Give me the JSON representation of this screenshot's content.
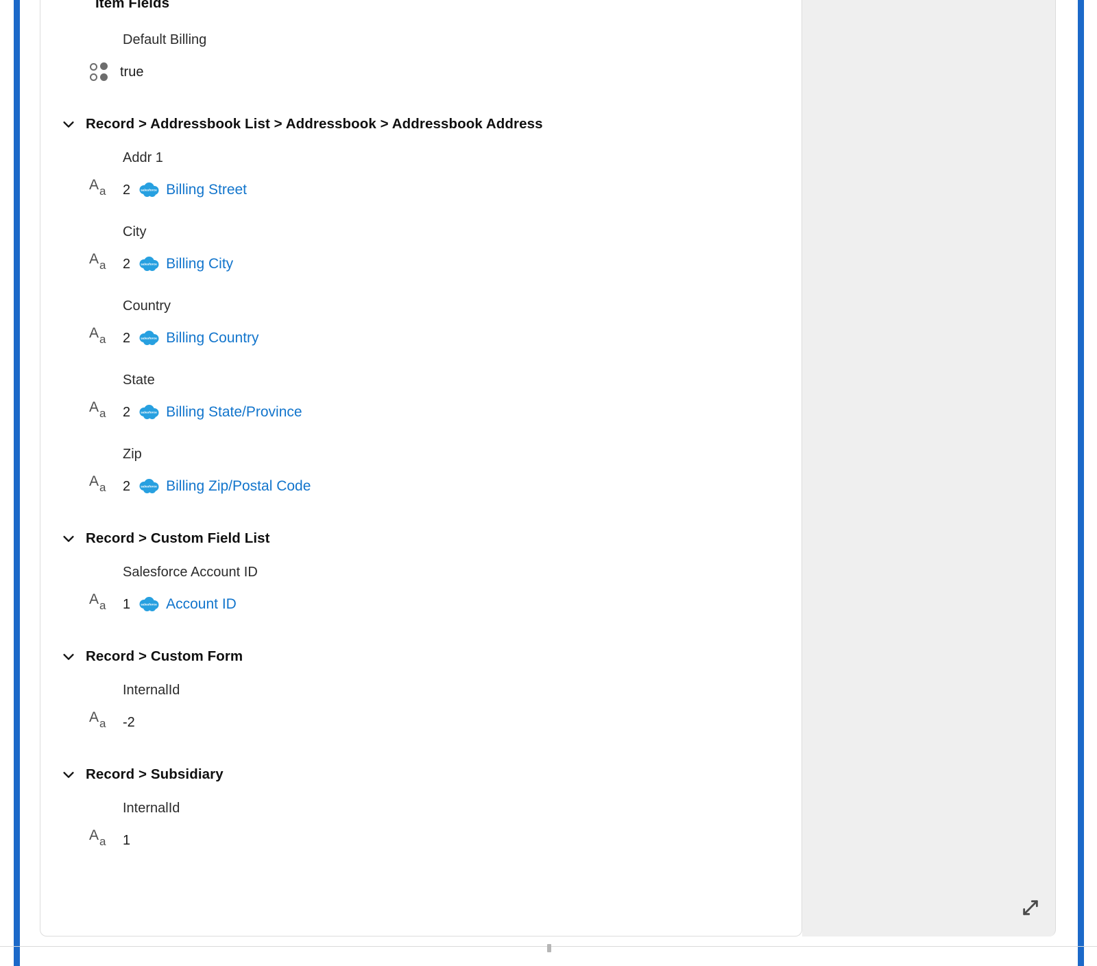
{
  "theme": {
    "rail_color": "#1b69c9",
    "link_color": "#1275cc",
    "panel_bg": "#efefef",
    "card_bg": "#ffffff",
    "border_color": "#dcdcdc"
  },
  "item_fields": {
    "heading": "Item Fields",
    "rows": [
      {
        "label": "Default Billing",
        "icon": "boolean-type-icon",
        "count": "",
        "value": "true",
        "source_icon": "",
        "link": ""
      }
    ]
  },
  "sections": [
    {
      "title": "Record > Addressbook List > Addressbook > Addressbook Address",
      "chevron": "chevron-down-icon",
      "rows": [
        {
          "label": "Addr 1",
          "icon": "text-type-icon",
          "count": "2",
          "source_icon": "salesforce-logo",
          "link": "Billing Street"
        },
        {
          "label": "City",
          "icon": "text-type-icon",
          "count": "2",
          "source_icon": "salesforce-logo",
          "link": "Billing City"
        },
        {
          "label": "Country",
          "icon": "text-type-icon",
          "count": "2",
          "source_icon": "salesforce-logo",
          "link": "Billing Country"
        },
        {
          "label": "State",
          "icon": "text-type-icon",
          "count": "2",
          "source_icon": "salesforce-logo",
          "link": "Billing State/Province"
        },
        {
          "label": "Zip",
          "icon": "text-type-icon",
          "count": "2",
          "source_icon": "salesforce-logo",
          "link": "Billing Zip/Postal Code"
        }
      ]
    },
    {
      "title": "Record > Custom Field List",
      "chevron": "chevron-down-icon",
      "rows": [
        {
          "label": "Salesforce Account ID",
          "icon": "text-type-icon",
          "count": "1",
          "source_icon": "salesforce-logo",
          "link": "Account ID"
        }
      ]
    },
    {
      "title": "Record > Custom Form",
      "chevron": "chevron-down-icon",
      "rows": [
        {
          "label": "InternalId",
          "icon": "text-type-icon",
          "count": "",
          "source_icon": "",
          "link": "",
          "value": "-2"
        }
      ]
    },
    {
      "title": "Record > Subsidiary",
      "chevron": "chevron-down-icon",
      "rows": [
        {
          "label": "InternalId",
          "icon": "text-type-icon",
          "count": "",
          "source_icon": "",
          "link": "",
          "value": "1"
        }
      ]
    }
  ],
  "side_panel": {
    "expand_icon": "expand-diagonal-icon"
  },
  "salesforce_logo_text": "salesforce"
}
